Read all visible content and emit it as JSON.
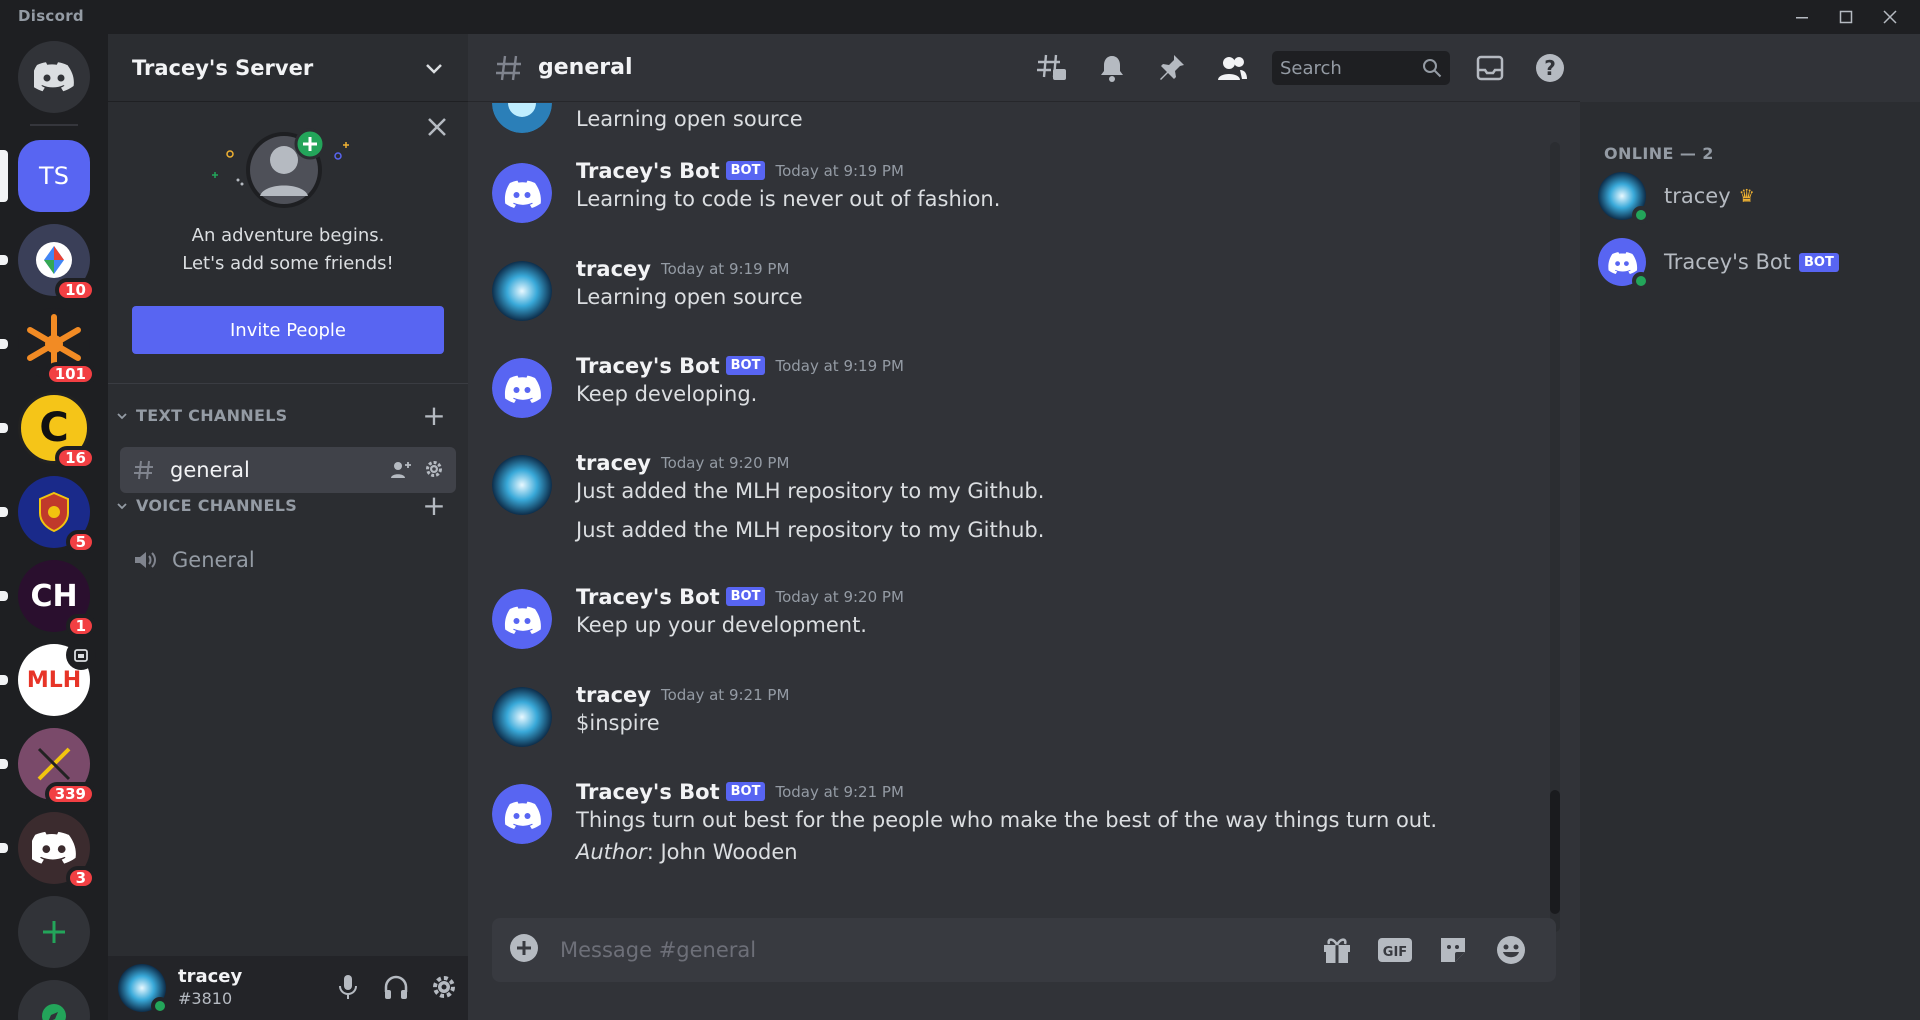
{
  "app": {
    "title": "Discord"
  },
  "guilds": [
    {
      "name": "home",
      "initials": ""
    },
    {
      "name": "Tracey's Server",
      "initials": "TS"
    },
    {
      "name": "server-2",
      "badge": "10"
    },
    {
      "name": "server-3",
      "badge": "101"
    },
    {
      "name": "server-4",
      "badge": "16"
    },
    {
      "name": "server-5",
      "badge": "5"
    },
    {
      "name": "server-6",
      "initials": "CH",
      "badge": "1"
    },
    {
      "name": "MLH",
      "initials": "MLH"
    },
    {
      "name": "server-8",
      "badge": "339"
    },
    {
      "name": "server-9",
      "badge": "3"
    }
  ],
  "server": {
    "name": "Tracey's Server",
    "invite_card": {
      "line1": "An adventure begins.",
      "line2": "Let's add some friends!",
      "button": "Invite People"
    },
    "categories": {
      "text": "TEXT CHANNELS",
      "voice": "VOICE CHANNELS"
    },
    "text_channels": [
      {
        "name": "general"
      }
    ],
    "voice_channels": [
      {
        "name": "General"
      }
    ]
  },
  "user": {
    "name": "tracey",
    "tag": "#3810"
  },
  "channel": {
    "name": "general",
    "search_placeholder": "Search",
    "composer_placeholder": "Message #general"
  },
  "messages": [
    {
      "text": "Learning open source"
    },
    {
      "author": "Tracey's Bot",
      "bot": "BOT",
      "time": "Today at 9:19 PM",
      "lines": [
        "Learning to code is never out of fashion."
      ]
    },
    {
      "author": "tracey",
      "time": "Today at 9:19 PM",
      "lines": [
        "Learning open source"
      ]
    },
    {
      "author": "Tracey's Bot",
      "bot": "BOT",
      "time": "Today at 9:19 PM",
      "lines": [
        "Keep developing."
      ]
    },
    {
      "author": "tracey",
      "time": "Today at 9:20 PM",
      "lines": [
        "Just added the MLH repository to my Github.",
        "Just added the MLH repository to my Github."
      ]
    },
    {
      "author": "Tracey's Bot",
      "bot": "BOT",
      "time": "Today at 9:20 PM",
      "lines": [
        "Keep up your development."
      ]
    },
    {
      "author": "tracey",
      "time": "Today at 9:21 PM",
      "lines": [
        "$inspire"
      ]
    },
    {
      "author": "Tracey's Bot",
      "bot": "BOT",
      "time": "Today at 9:21 PM",
      "lines": [
        "Things turn out best for the people who make the best of the way things turn out."
      ],
      "author_label": "Author",
      "author_value": ": John Wooden"
    }
  ],
  "members": {
    "heading": "ONLINE — 2",
    "list": [
      {
        "name": "tracey",
        "crown": "♛"
      },
      {
        "name": "Tracey's Bot",
        "bot": "BOT"
      }
    ]
  },
  "colors": {
    "blurple": "#5865f2",
    "online": "#23a55a",
    "badge": "#f23f43"
  }
}
